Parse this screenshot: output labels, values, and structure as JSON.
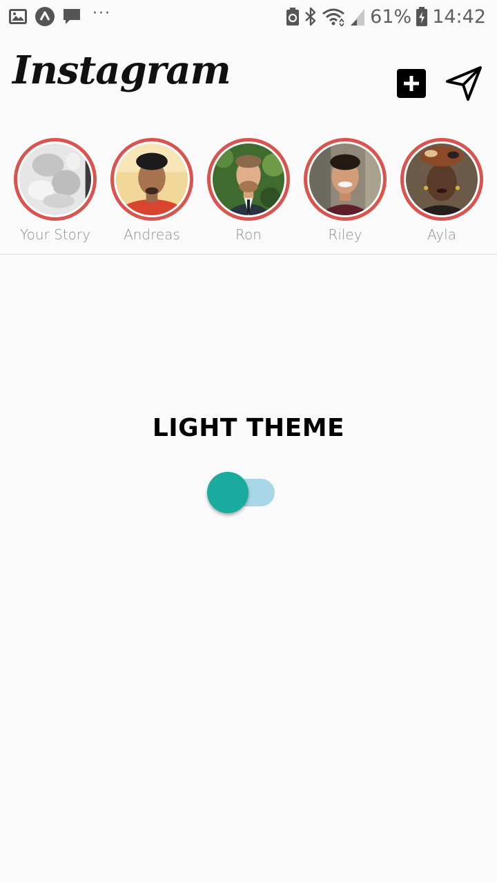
{
  "status_bar": {
    "battery": "61%",
    "time": "14:42",
    "left_icons": [
      "image-icon",
      "app-icon",
      "message-icon",
      "more-dots-icon"
    ],
    "right_icons": [
      "battery-saver-icon",
      "bluetooth-icon",
      "wifi-icon",
      "signal-icon",
      "battery-icon"
    ]
  },
  "header": {
    "logo": "Instagram",
    "actions": [
      "add-post-icon",
      "send-icon"
    ]
  },
  "stories": [
    {
      "name": "Your Story"
    },
    {
      "name": "Andreas"
    },
    {
      "name": "Ron"
    },
    {
      "name": "Riley"
    },
    {
      "name": "Ayla"
    }
  ],
  "main": {
    "title": "LIGHT THEME",
    "toggle_on": true
  },
  "colors": {
    "story_ring": "#d9534f",
    "toggle_knob": "#1aab9f",
    "toggle_track": "#a8d8e8",
    "background": "#fafafa"
  }
}
